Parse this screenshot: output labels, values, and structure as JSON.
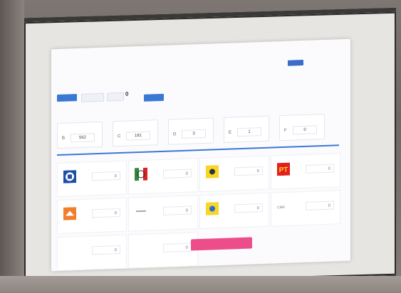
{
  "header": {
    "cols": [
      {
        "label": "",
        "value": ""
      },
      {
        "label": "",
        "value": ""
      },
      {
        "label": "",
        "value": ""
      },
      {
        "label": "",
        "value": ""
      },
      {
        "label": "",
        "value": ""
      },
      {
        "label": "",
        "value": ""
      },
      {
        "label": "",
        "value": ""
      }
    ],
    "badge": ""
  },
  "actions": {
    "primary_left": "",
    "ghost_1": "",
    "ghost_2": "",
    "big_zero": "0",
    "primary_right": ""
  },
  "right_meta": [
    {
      "label": "",
      "value": ""
    },
    {
      "label": "",
      "value": ""
    },
    {
      "label": "",
      "value": ""
    },
    {
      "label": "",
      "value": ""
    },
    {
      "label": "",
      "value": ""
    }
  ],
  "stats": [
    {
      "label": "",
      "code": "B",
      "value": "562"
    },
    {
      "label": "",
      "code": "C",
      "value": "181"
    },
    {
      "label": "",
      "code": "D",
      "value": "3"
    },
    {
      "label": "",
      "code": "E",
      "value": "1"
    },
    {
      "label": "",
      "code": "F",
      "value": "0"
    }
  ],
  "parties_row1": [
    {
      "logo": "pan-logo",
      "value": "0"
    },
    {
      "logo": "pri-logo",
      "value": "0"
    },
    {
      "logo": "prd-logo",
      "value": "0"
    },
    {
      "logo": "pt-logo",
      "value": "0",
      "text": "PT"
    }
  ],
  "parties_row2": [
    {
      "logo": "mc-logo",
      "value": "0"
    },
    {
      "logo": "dash",
      "value": "0"
    },
    {
      "logo": "coalition-logo",
      "value": "0"
    },
    {
      "logo": "cn-label",
      "value": "0",
      "text": "CNR"
    }
  ],
  "row3": {
    "left_label": "",
    "left_value": "0",
    "middle_label": "",
    "middle_value": "0",
    "submit_label": ""
  },
  "colors": {
    "accent_blue": "#3b78d4",
    "submit_pink": "#ee4d8c"
  }
}
